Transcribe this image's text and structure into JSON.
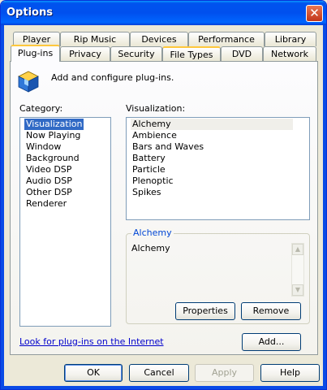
{
  "window": {
    "title": "Options",
    "close_glyph": "✕"
  },
  "tabs_row1": [
    "Player",
    "Rip Music",
    "Devices",
    "Performance",
    "Library"
  ],
  "tabs_row2": [
    "Plug-ins",
    "Privacy",
    "Security",
    "File Types",
    "DVD",
    "Network"
  ],
  "active_tab": "Plug-ins",
  "header": {
    "icon": "plugin-cube-icon",
    "text": "Add and configure plug-ins."
  },
  "category": {
    "label": "Category:",
    "items": [
      "Visualization",
      "Now Playing",
      "Window",
      "Background",
      "Video DSP",
      "Audio DSP",
      "Other DSP",
      "Renderer"
    ],
    "selected": "Visualization"
  },
  "visualization": {
    "label": "Visualization:",
    "items": [
      "Alchemy",
      "Ambience",
      "Bars and Waves",
      "Battery",
      "Particle",
      "Plenoptic",
      "Spikes"
    ],
    "selected": "Alchemy"
  },
  "details": {
    "title": "Alchemy",
    "text": "Alchemy"
  },
  "buttons": {
    "properties": "Properties",
    "remove": "Remove",
    "add": "Add...",
    "ok": "OK",
    "cancel": "Cancel",
    "apply": "Apply",
    "help": "Help"
  },
  "link": "Look for plug-ins on the Internet",
  "colors": {
    "selection": "#316ac5",
    "titlebar": "#0050ee",
    "link": "#0000cc",
    "group_title": "#0046d5"
  }
}
